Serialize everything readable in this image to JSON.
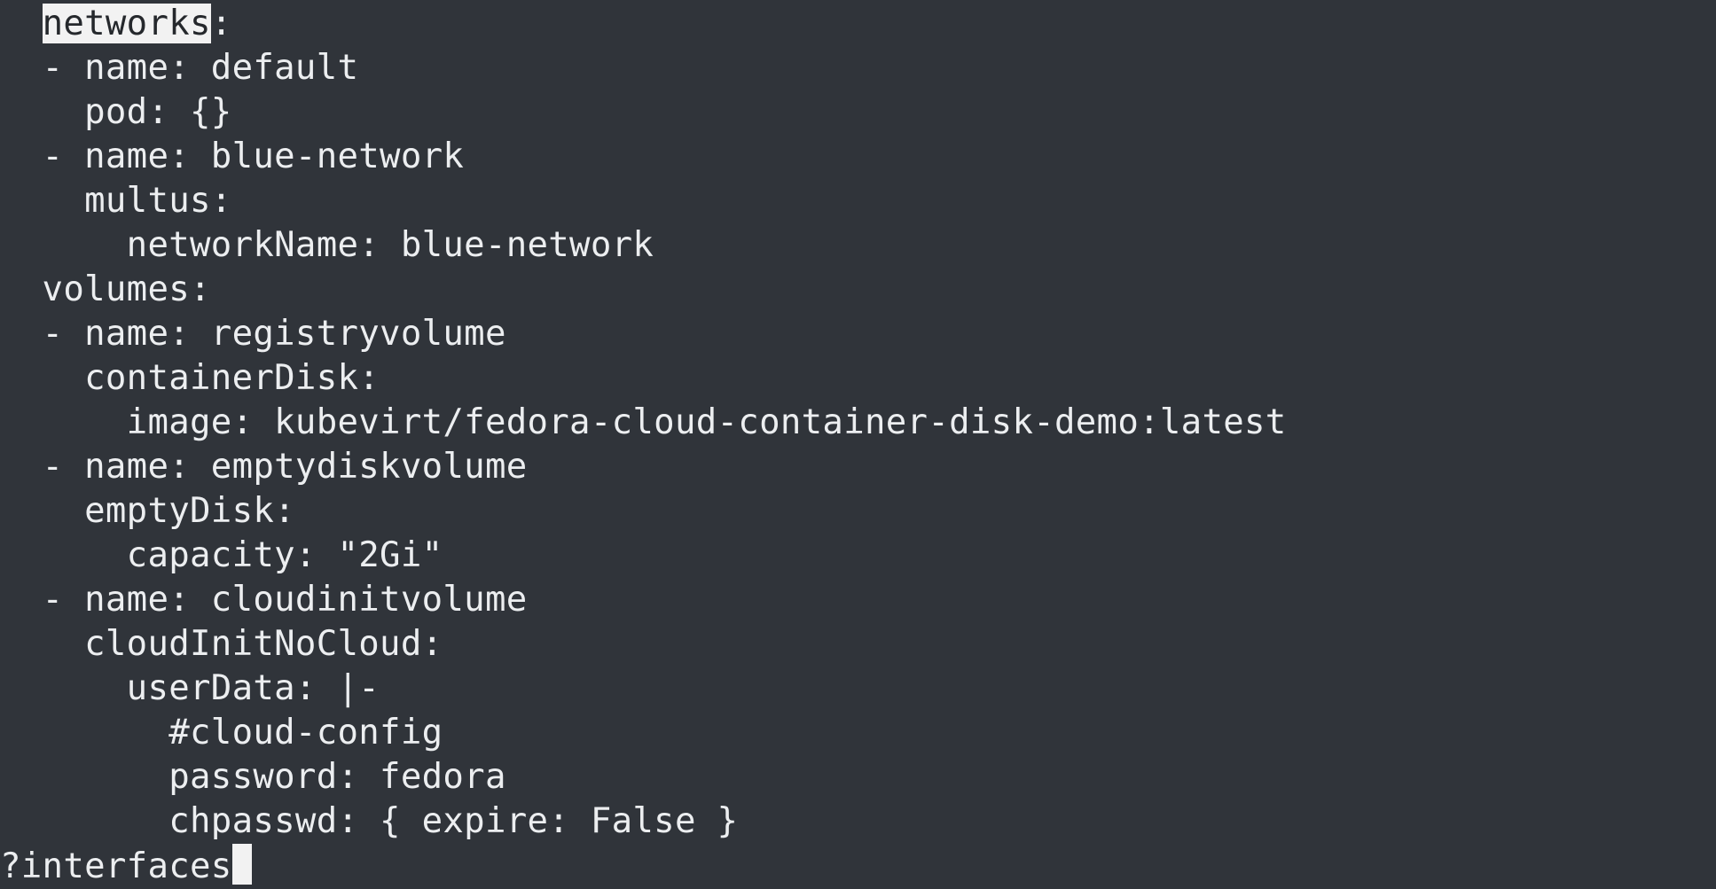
{
  "terminal": {
    "search_match": "networks",
    "first_line_rest": ":",
    "lines": [
      "  - name: default",
      "    pod: {}",
      "  - name: blue-network",
      "    multus:",
      "      networkName: blue-network",
      "  volumes:",
      "  - name: registryvolume",
      "    containerDisk:",
      "      image: kubevirt/fedora-cloud-container-disk-demo:latest",
      "  - name: emptydiskvolume",
      "    emptyDisk:",
      "      capacity: \"2Gi\"",
      "  - name: cloudinitvolume",
      "    cloudInitNoCloud:",
      "      userData: |-",
      "        #cloud-config",
      "        password: fedora",
      "        chpasswd: { expire: False }"
    ],
    "search_prompt": "?interfaces"
  }
}
